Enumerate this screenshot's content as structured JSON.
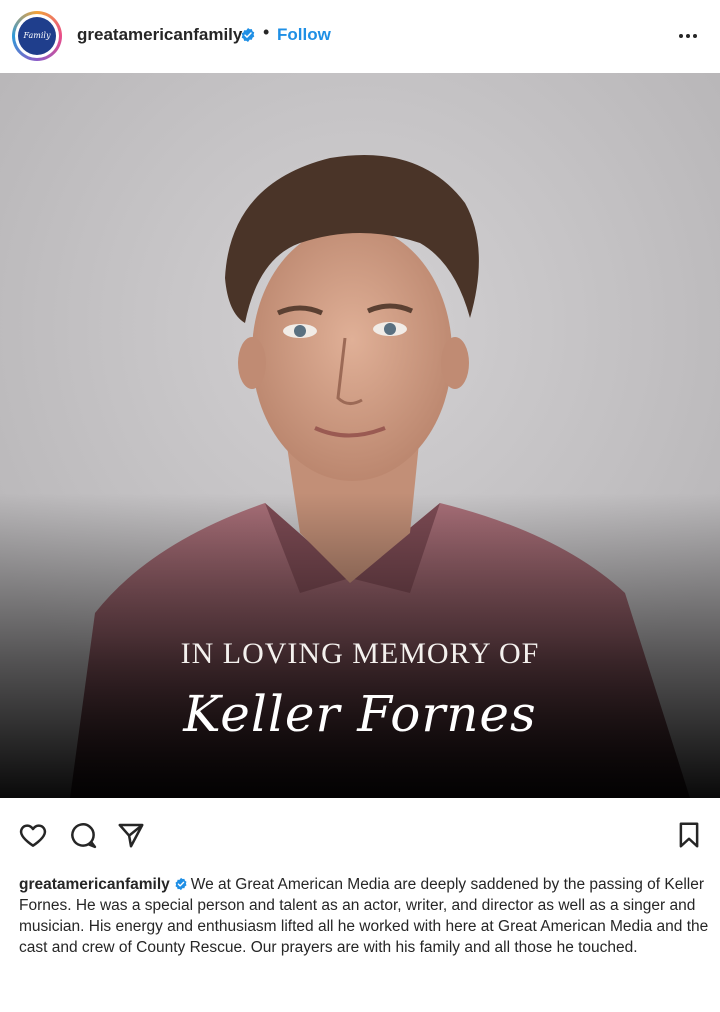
{
  "post": {
    "username": "greatamericanfamily",
    "follow_label": "Follow",
    "separator": "•",
    "avatar_text": "Family",
    "image": {
      "overlay_line": "IN LOVING MEMORY OF",
      "overlay_name": "Keller Fornes"
    },
    "caption": {
      "username": "greatamericanfamily",
      "text": "We at Great American Media are deeply saddened by the passing of Keller Fornes. He was a special person and talent as an actor, writer, and director as well as a singer and musician. His energy and enthusiasm lifted all he worked with here at Great American Media and the cast and crew of County Rescue. Our prayers are with his family and all those he touched."
    }
  },
  "icons": {
    "verified": "verified-badge-icon",
    "more": "more-options-icon",
    "like": "heart-icon",
    "comment": "comment-icon",
    "share": "send-icon",
    "save": "bookmark-icon"
  },
  "colors": {
    "follow": "#1f8fe5",
    "verified": "#1f8fe5",
    "text": "#262626"
  }
}
